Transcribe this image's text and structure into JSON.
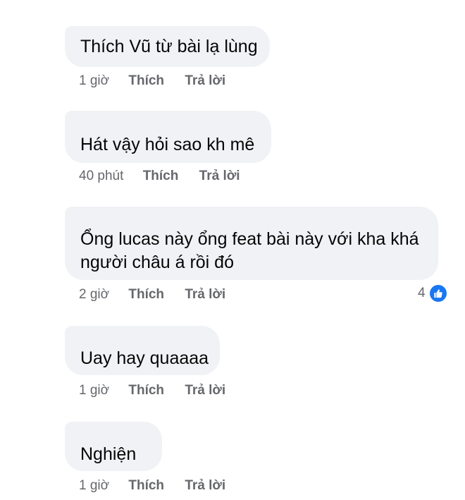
{
  "comments": [
    {
      "text_lines": [
        "Thích Vũ từ bài lạ lùng"
      ],
      "time": "1 giờ",
      "like_label": "Thích",
      "reply_label": "Trả lời"
    },
    {
      "text_lines": [
        "Hát vậy hỏi sao kh mê"
      ],
      "time": "40 phút",
      "like_label": "Thích",
      "reply_label": "Trả lời"
    },
    {
      "text_lines": [
        "Ổng lucas này ổng feat bài này với kha khá",
        "người châu á rồi đó"
      ],
      "time": "2 giờ",
      "like_label": "Thích",
      "reply_label": "Trả lời",
      "reaction_count": "4",
      "reaction_icon": "like-icon",
      "reaction_color": "#1877f2"
    },
    {
      "text_lines": [
        "Uay hay quaaaa"
      ],
      "time": "1 giờ",
      "like_label": "Thích",
      "reply_label": "Trả lời"
    },
    {
      "text_lines": [
        "Nghiện"
      ],
      "time": "1 giờ",
      "like_label": "Thích",
      "reply_label": "Trả lời"
    }
  ]
}
